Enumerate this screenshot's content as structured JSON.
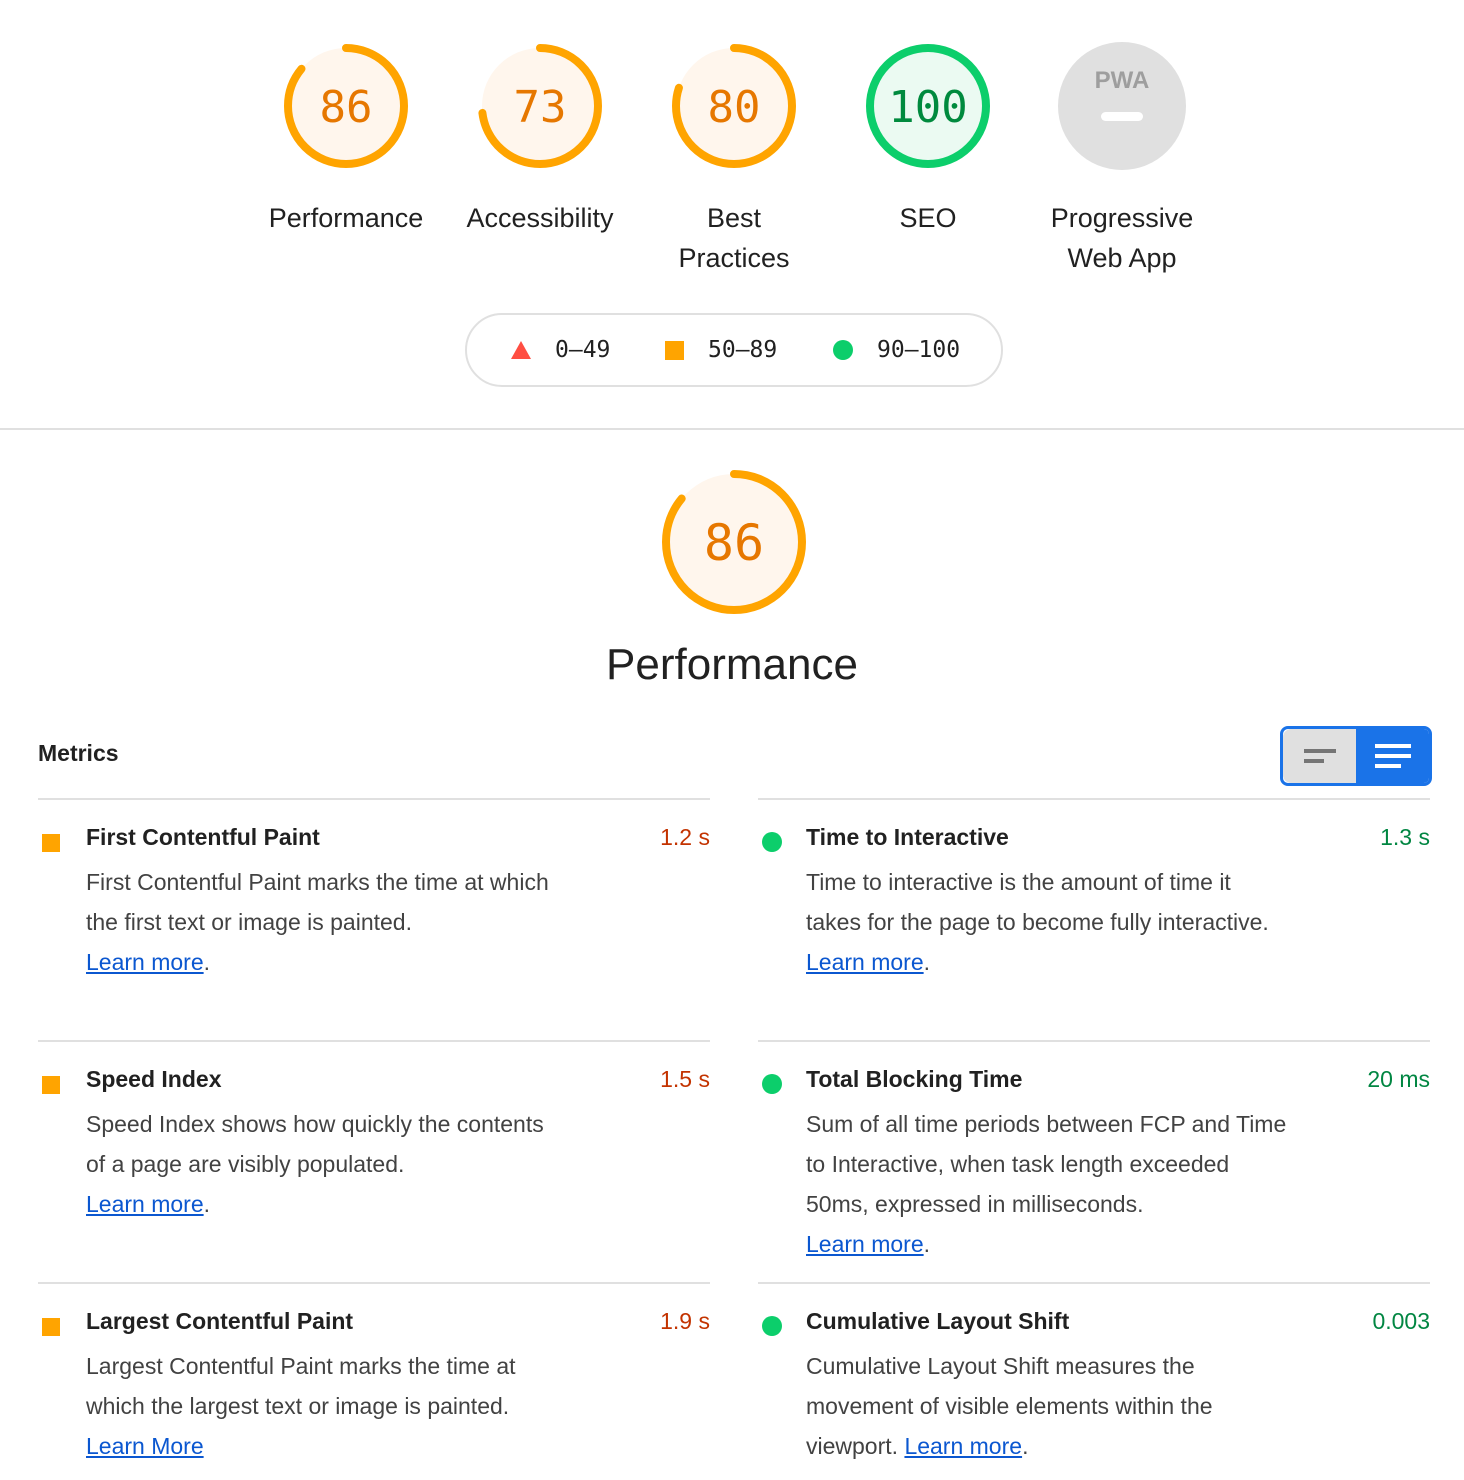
{
  "colors": {
    "fail": "#ff4e42",
    "average": "#ffa400",
    "pass": "#0cce6b",
    "average_bg": "#fff6ed",
    "pass_bg": "#ebfaf2",
    "na": "#e0e0e0",
    "accent": "#1a73e8"
  },
  "gauges": [
    {
      "score": "86",
      "value": 86,
      "label": "Performance",
      "status": "average"
    },
    {
      "score": "73",
      "value": 73,
      "label": "Accessibility",
      "status": "average"
    },
    {
      "score": "80",
      "value": 80,
      "label": "Best Practices",
      "status": "average"
    },
    {
      "score": "100",
      "value": 100,
      "label": "SEO",
      "status": "pass"
    },
    {
      "score": "PWA",
      "label": "Progressive Web App",
      "status": "na"
    }
  ],
  "legend": [
    {
      "icon": "triangle-icon",
      "range": "0–49"
    },
    {
      "icon": "square-icon",
      "range": "50–89"
    },
    {
      "icon": "circle-icon",
      "range": "90–100"
    }
  ],
  "performance": {
    "score": "86",
    "value": 86,
    "title": "Performance"
  },
  "metrics_heading": "Metrics",
  "metrics": [
    {
      "title": "First Contentful Paint",
      "value": "1.2 s",
      "status": "average",
      "desc": "First Contentful Paint marks the time at which the first text or image is painted.",
      "link": "Learn more",
      "suffix": "."
    },
    {
      "title": "Time to Interactive",
      "value": "1.3 s",
      "status": "pass",
      "desc": "Time to interactive is the amount of time it takes for the page to become fully interactive.",
      "link": "Learn more",
      "suffix": "."
    },
    {
      "title": "Speed Index",
      "value": "1.5 s",
      "status": "average",
      "desc": "Speed Index shows how quickly the contents of a page are visibly populated.",
      "link": "Learn more",
      "suffix": "."
    },
    {
      "title": "Total Blocking Time",
      "value": "20 ms",
      "status": "pass",
      "desc": "Sum of all time periods between FCP and Time to Interactive, when task length exceeded 50ms, expressed in milliseconds.",
      "link": "Learn more",
      "suffix": "."
    },
    {
      "title": "Largest Contentful Paint",
      "value": "1.9 s",
      "status": "average",
      "desc": "Largest Contentful Paint marks the time at which the largest text or image is painted.",
      "link": "Learn More",
      "suffix": ""
    },
    {
      "title": "Cumulative Layout Shift",
      "value": "0.003",
      "status": "pass",
      "desc": "Cumulative Layout Shift measures the movement of visible elements within the viewport.",
      "link": "Learn more",
      "suffix": "."
    }
  ]
}
